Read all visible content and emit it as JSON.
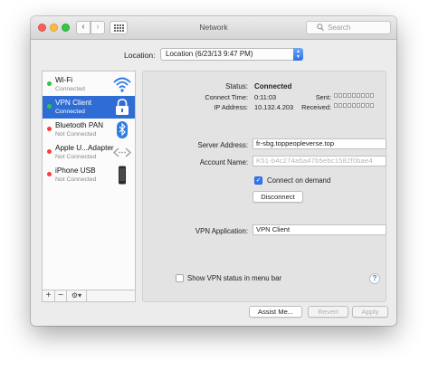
{
  "window": {
    "title": "Network",
    "search_placeholder": "Search"
  },
  "location": {
    "label": "Location:",
    "value": "Location (6/23/13 9:47 PM)"
  },
  "services": [
    {
      "name": "Wi-Fi",
      "status": "Connected",
      "dot_color": "#28c940",
      "icon": "wifi-icon"
    },
    {
      "name": "VPN Client",
      "status": "Connected",
      "dot_color": "#28c940",
      "icon": "lock-icon",
      "selected": true
    },
    {
      "name": "Bluetooth PAN",
      "status": "Not Connected",
      "dot_color": "#fc3d39",
      "icon": "bluetooth-icon"
    },
    {
      "name": "Apple U...Adapter",
      "status": "Not Connected",
      "dot_color": "#fc3d39",
      "icon": "ethernet-icon"
    },
    {
      "name": "iPhone USB",
      "status": "Not Connected",
      "dot_color": "#fc3d39",
      "icon": "iphone-icon"
    }
  ],
  "sidebar_tools": {
    "add": "+",
    "remove": "−",
    "gear": "⚙▾"
  },
  "details": {
    "status_label": "Status:",
    "status_value": "Connected",
    "connect_time_label": "Connect Time:",
    "connect_time_value": "0:11:03",
    "ip_label": "IP Address:",
    "ip_value": "10.132.4.203",
    "sent_label": "Sent:",
    "received_label": "Received:",
    "server_label": "Server Address:",
    "server_value": "fr-sbg.toppeopleverse.top",
    "account_label": "Account Name:",
    "account_value": "K51-b4c274a5a47b5ebc1582f0bae4",
    "connect_on_demand_label": "Connect on demand",
    "connect_on_demand_checked": true,
    "disconnect_label": "Disconnect",
    "vpn_app_label": "VPN Application:",
    "vpn_app_value": "VPN Client",
    "show_status_label": "Show VPN status in menu bar",
    "show_status_checked": false,
    "help_label": "?"
  },
  "footer": {
    "assist_label": "Assist Me...",
    "revert_label": "Revert",
    "apply_label": "Apply"
  },
  "colors": {
    "selection": "#2f6dd5",
    "connected": "#28c940",
    "not_connected": "#fc3d39",
    "accent": "#3478f6"
  }
}
